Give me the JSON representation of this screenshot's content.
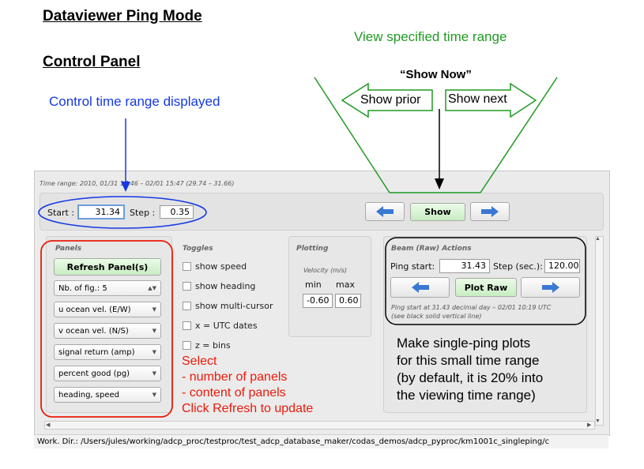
{
  "slide": {
    "title": "Dataviewer Ping Mode",
    "subtitle": "Control Panel",
    "green_note": "View specified time range",
    "blue_note": "Control time range displayed",
    "show_now": "“Show Now”",
    "show_prior": "Show prior",
    "show_next": "Show next",
    "red_note": [
      "Select",
      "- number of panels",
      "- content of panels",
      "Click Refresh to update"
    ],
    "black_note": [
      "Make single-ping plots",
      "for this small time range",
      "(by default, it is 20% into",
      "the viewing time range)"
    ]
  },
  "app": {
    "time_range": "Time range: 2010, 01/31 17:46 – 02/01 15:47 (29.74 – 31.66)",
    "start_label": "Start :",
    "start_value": "31.34",
    "step_label": "Step :",
    "step_value": "0.35",
    "show_button": "Show",
    "panels": {
      "title": "Panels",
      "refresh": "Refresh Panel(s)",
      "nfig": "Nb. of fig.: 5",
      "dropdowns": [
        "u ocean vel. (E/W)",
        "v ocean vel. (N/S)",
        "signal return (amp)",
        "percent good (pg)",
        "heading, speed"
      ]
    },
    "toggles": {
      "title": "Toggles",
      "items": [
        "show speed",
        "show heading",
        "show multi-cursor",
        "x = UTC dates",
        "z = bins"
      ]
    },
    "plotting": {
      "title": "Plotting",
      "velocity": "Velocity (m/s)",
      "min_label": "min",
      "max_label": "max",
      "min_value": "-0.60",
      "max_value": "0.60"
    },
    "beam": {
      "title": "Beam (Raw) Actions",
      "ping_label": "Ping start:",
      "ping_value": "31.43",
      "step_label": "Step (sec.):",
      "step_value": "120.00",
      "plot_raw": "Plot Raw",
      "info1": "Ping start at 31.43 decimal day – 02/01 10:19 UTC",
      "info2": "(see black solid vertical line)"
    },
    "workdir": "Work. Dir.: /Users/jules/working/adcp_proc/testproc/test_adcp_database_maker/codas_demos/adcp_pyproc/km1001c_singleping/c"
  },
  "colors": {
    "green": "#1f9a22",
    "blue": "#1438e6",
    "red": "#ea1a0a",
    "arrow_blue": "#3a78d4"
  }
}
